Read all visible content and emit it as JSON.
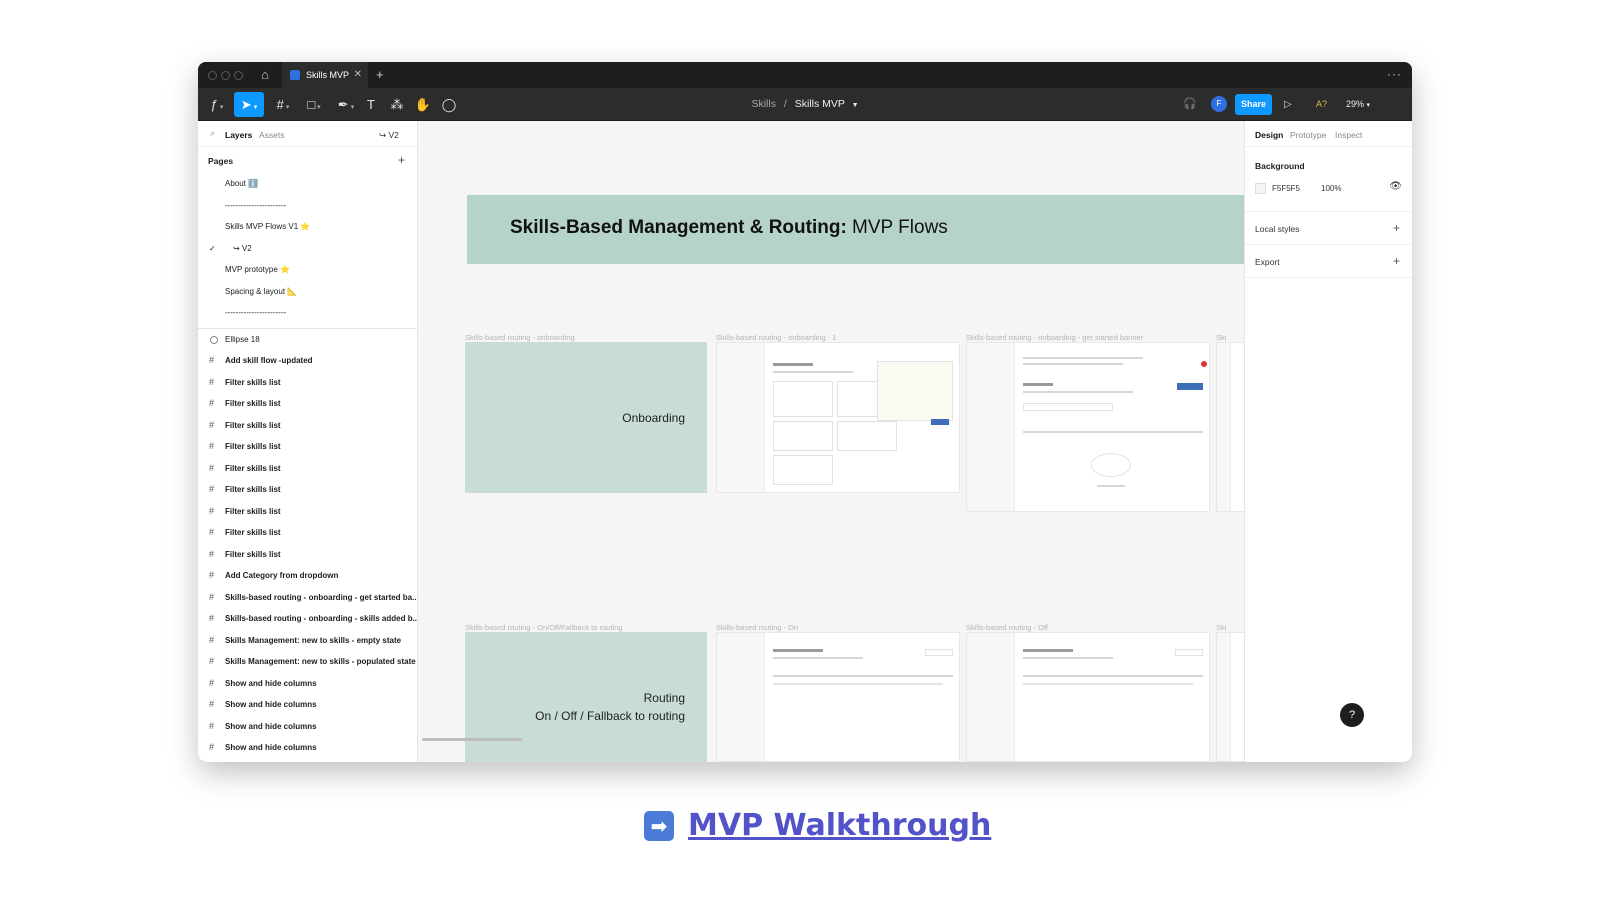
{
  "window": {
    "tab_title": "Skills MVP",
    "tab_close": "✕",
    "tab_add": "+",
    "more": "···"
  },
  "toolbar": {
    "breadcrumb_parent": "Skills",
    "breadcrumb_sep": "/",
    "breadcrumb_current": "Skills MVP",
    "avatar_initial": "F",
    "share_label": "Share",
    "zoom": "29%",
    "tools": [
      "main-menu",
      "move",
      "frame",
      "shape",
      "pen",
      "text",
      "components",
      "hand",
      "comment"
    ]
  },
  "left_panel": {
    "tab_layers": "Layers",
    "tab_assets": "Assets",
    "page_switch": "↪ V2",
    "pages_title": "Pages",
    "pages_add": "+",
    "pages": [
      {
        "label": "About ℹ️",
        "current": false
      },
      {
        "label": "-----------------------",
        "current": false
      },
      {
        "label": "Skills MVP Flows V1 ⭐",
        "current": false
      },
      {
        "label": "↪ V2",
        "current": true
      },
      {
        "label": "MVP prototype ⭐",
        "current": false
      },
      {
        "label": "Spacing & layout 📐",
        "current": false
      },
      {
        "label": "-----------------------",
        "current": false
      }
    ],
    "layers": [
      {
        "label": "Ellipse 18",
        "type": "ellipse"
      },
      {
        "label": "Add skill flow -updated",
        "type": "frame"
      },
      {
        "label": "Filter skills list",
        "type": "frame"
      },
      {
        "label": "Filter skills list",
        "type": "frame"
      },
      {
        "label": "Filter skills list",
        "type": "frame"
      },
      {
        "label": "Filter skills list",
        "type": "frame"
      },
      {
        "label": "Filter skills list",
        "type": "frame"
      },
      {
        "label": "Filter skills list",
        "type": "frame"
      },
      {
        "label": "Filter skills list",
        "type": "frame"
      },
      {
        "label": "Filter skills list",
        "type": "frame"
      },
      {
        "label": "Filter skills list",
        "type": "frame"
      },
      {
        "label": "Add Category from dropdown",
        "type": "frame"
      },
      {
        "label": "Skills-based routing - onboarding - get started ba...",
        "type": "frame"
      },
      {
        "label": "Skills-based routing - onboarding -  skills added b...",
        "type": "frame"
      },
      {
        "label": "Skills Management: new to skills - empty state",
        "type": "frame"
      },
      {
        "label": "Skills Management: new to skills - populated state",
        "type": "frame"
      },
      {
        "label": "Show and hide columns",
        "type": "frame"
      },
      {
        "label": "Show and hide columns",
        "type": "frame"
      },
      {
        "label": "Show and hide columns",
        "type": "frame"
      },
      {
        "label": "Show and hide columns",
        "type": "frame"
      }
    ]
  },
  "canvas": {
    "banner_bold": "Skills-Based Management & Routing:",
    "banner_rest": " MVP Flows",
    "frame_labels": {
      "onboarding": "Skills-based routing - onboarding",
      "onboarding_1": "Skills-based routing - onboarding - 1",
      "get_started": "Skills-based routing - onboarding - get started banner",
      "cut_1": "Ski",
      "routing": "Skills-based routing - On/Off/Fallback to routing",
      "on": "Skills-based routing - On",
      "off": "Skills-based routing - Off",
      "cut_2": "Ski"
    },
    "onboarding_title": "Onboarding",
    "routing_title_1": "Routing",
    "routing_title_2": "On / Off / Fallback to routing"
  },
  "right_panel": {
    "tab_design": "Design",
    "tab_prototype": "Prototype",
    "tab_inspect": "Inspect",
    "background_title": "Background",
    "background_hex": "F5F5F5",
    "background_opacity": "100%",
    "local_styles": "Local styles",
    "export": "Export",
    "plus": "+"
  },
  "help_label": "?",
  "footer_link": "MVP Walkthrough",
  "colors": {
    "accent": "#0d99ff",
    "banner": "#b6d3c9",
    "section_green": "#c7ddd5",
    "canvas_bg": "#f5f5f5",
    "link": "#5353c9"
  }
}
